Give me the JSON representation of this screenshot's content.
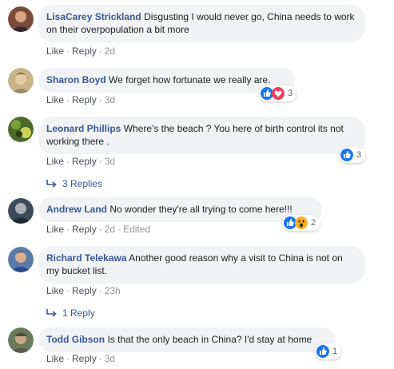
{
  "actions": {
    "like": "Like",
    "reply": "Reply",
    "dot": "·",
    "edited": "Edited"
  },
  "comments": [
    {
      "author": "LisaCarey Strickland",
      "text": "Disgusting I would never go, China needs to work on their overpopulation a bit more",
      "time": "2d"
    },
    {
      "author": "Sharon Boyd",
      "text": "We forget how fortunate we really are.",
      "time": "3d",
      "reactions": {
        "types": [
          "like-icon",
          "love-icon"
        ],
        "count": "3"
      }
    },
    {
      "author": "Leonard Phillips",
      "text": "Where's the beach ? You here of birth control its not working there .",
      "time": "3d",
      "reactions": {
        "types": [
          "like-icon"
        ],
        "count": "3"
      },
      "replies_label": "3 Replies"
    },
    {
      "author": "Andrew Land",
      "text": "No wonder they're all trying to come here!!!",
      "time": "2d",
      "edited": true,
      "reactions": {
        "types": [
          "like-icon",
          "wow-icon"
        ],
        "count": "2"
      }
    },
    {
      "author": "Richard Telekawa",
      "text": "Another good reason why a visit to China is not on my bucket list.",
      "time": "23h",
      "replies_label": "1 Reply"
    },
    {
      "author": "Todd Gibson",
      "text": "Is that the only beach in China? I'd stay at home",
      "time": "3d",
      "reactions": {
        "types": [
          "like-icon"
        ],
        "count": "1"
      }
    }
  ],
  "colors": {
    "author": "#385898",
    "bubble": "#f2f3f5",
    "like_blue": "#1877f2",
    "love_red": "#f33e58",
    "wow_yellow": "#f7b125"
  }
}
